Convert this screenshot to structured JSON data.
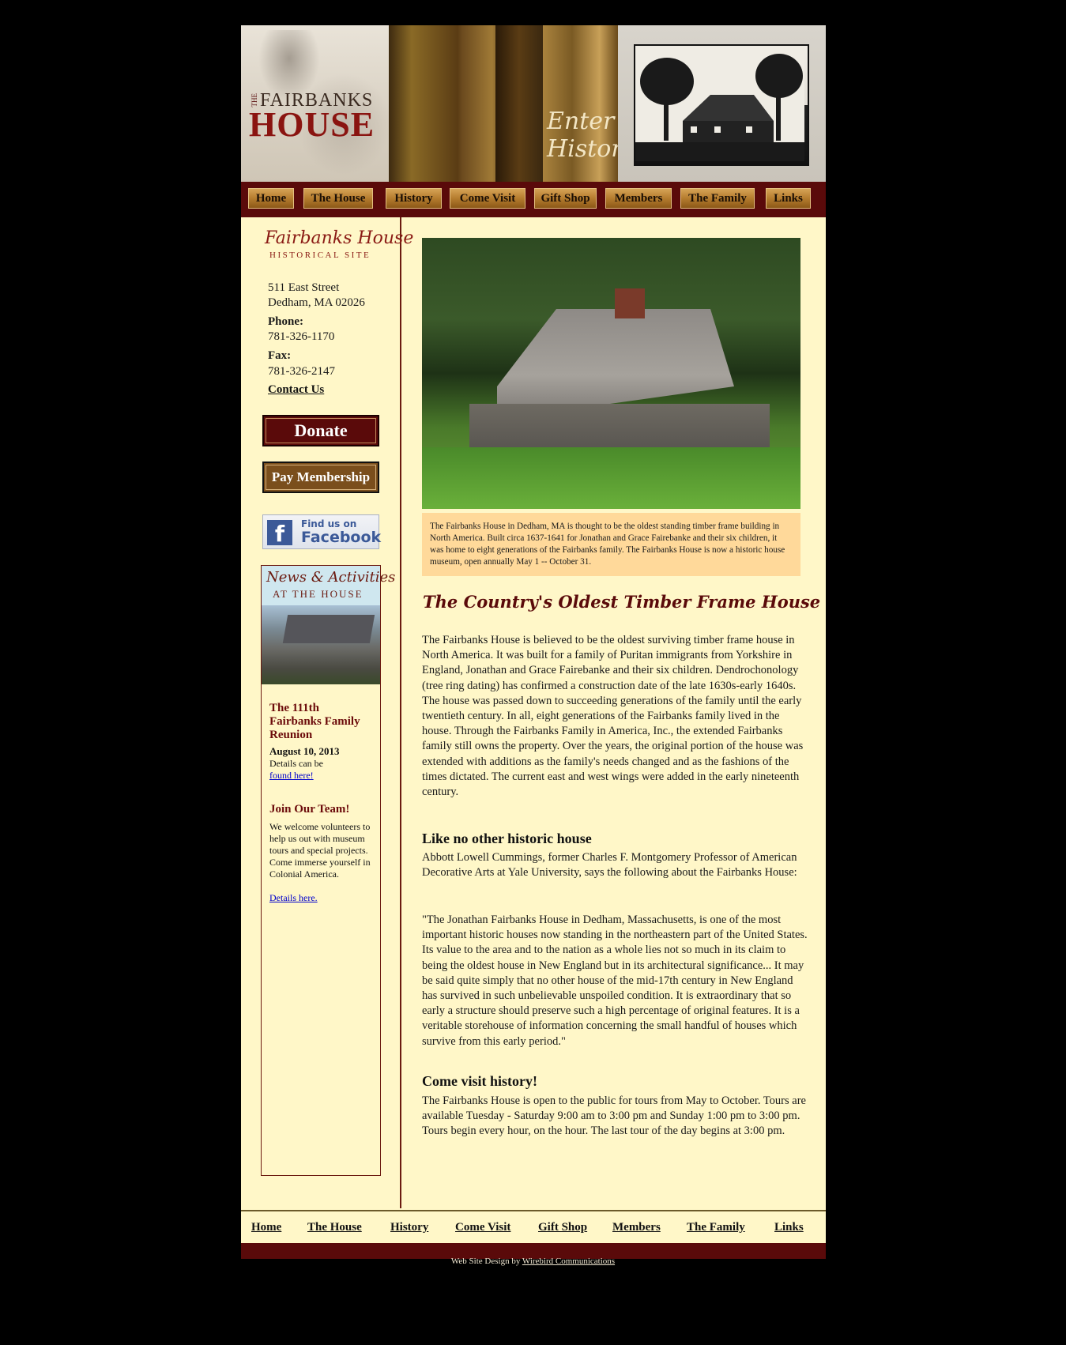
{
  "header": {
    "logo_the": "THE",
    "logo_fairbanks": "FAIRBANKS",
    "logo_house": "HOUSE",
    "tagline": "Enter History"
  },
  "nav": [
    {
      "label": "Home"
    },
    {
      "label": "The House"
    },
    {
      "label": "History"
    },
    {
      "label": "Come Visit"
    },
    {
      "label": "Gift Shop"
    },
    {
      "label": "Members"
    },
    {
      "label": "The Family"
    },
    {
      "label": "Links"
    }
  ],
  "sidebar": {
    "logo_name": "Fairbanks House",
    "logo_sub": "HISTORICAL SITE",
    "address1": "511 East Street",
    "address2": "Dedham, MA 02026",
    "phone_label": "Phone:",
    "phone": "781-326-1170",
    "fax_label": "Fax:",
    "fax": "781-326-2147",
    "contact_label": "Contact Us",
    "donate_label": "Donate",
    "membership_label": "Pay Membership",
    "facebook_line1": "Find us on",
    "facebook_line2": "Facebook",
    "news": {
      "title_script": "News & Activities",
      "title_caps": "AT THE HOUSE",
      "item1_heading": "The 111th Fairbanks Family Reunion",
      "item1_date": "August 10, 2013",
      "item1_text": "Details can be",
      "item1_link": "found here!",
      "item2_heading": "Join Our Team!",
      "item2_text": "We welcome volunteers to help us out with museum tours and special projects. Come immerse yourself in Colonial America.",
      "item2_link": "Details here."
    }
  },
  "content": {
    "caption": "The Fairbanks House in Dedham, MA is thought to be the oldest standing timber frame building in North America. Built circa 1637-1641 for Jonathan and Grace Fairebanke and their six children, it was home to eight generations of the Fairbanks family. The Fairbanks House is now a historic house museum, open annually May 1 -- October 31.",
    "title": "The Country's Oldest Timber Frame House",
    "para1": "The Fairbanks House is believed to be the oldest surviving timber frame house in North America. It was built for a family of Puritan immigrants from Yorkshire in England, Jonathan and Grace Fairebanke and their six children. Dendrochonology (tree ring dating) has confirmed a construction date of the late 1630s-early 1640s.  The house was passed down to succeeding generations of the family until the early twentieth century. In all, eight generations of the Fairbanks family lived in the house.  Through the Fairbanks Family in America, Inc., the extended Fairbanks family still owns the property. Over the years, the original portion of the house was extended with additions as the family's needs changed and as the fashions of the times dictated.  The current east and west wings were added in the early nineteenth century.",
    "heading2": "Like no other historic house",
    "para2": "Abbott Lowell Cummings, former Charles F. Montgomery Professor of American Decorative Arts at Yale University, says the following about the Fairbanks House:",
    "quote": "\"The Jonathan Fairbanks House in Dedham, Massachusetts, is one of the most important historic houses now standing in the northeastern part of the United States. Its value to the area and to the nation as a whole lies not so much in its claim to being the oldest house in New England but in its architectural significance... It may be said quite simply that no other house of the mid-17th century in New England has survived in such unbelievable unspoiled condition. It is extraordinary that so early a structure should preserve such a high percentage of original features. It is a veritable storehouse of information concerning the small handful of houses which survive from this early period.\"",
    "heading3": "Come visit history!",
    "para3": "The Fairbanks House is open to the public for tours from May to October. Tours are available Tuesday - Saturday 9:00 am to 3:00 pm and Sunday 1:00 pm to 3:00 pm. Tours begin every hour, on the hour. The last tour of the day begins at 3:00 pm."
  },
  "footer": {
    "links": [
      "Home",
      "The House",
      "History",
      "Come Visit",
      "Gift Shop",
      "Members",
      "The Family",
      "Links"
    ],
    "credit_prefix": "Web Site Design by",
    "credit_link": "Wirebird Communications"
  },
  "colors": {
    "page_bg": "#000000",
    "content_bg": "#fff7c8",
    "nav_bar": "#5a0a0a",
    "accent_red": "#6b0a0a",
    "caption_bg": "#ffd99a"
  }
}
